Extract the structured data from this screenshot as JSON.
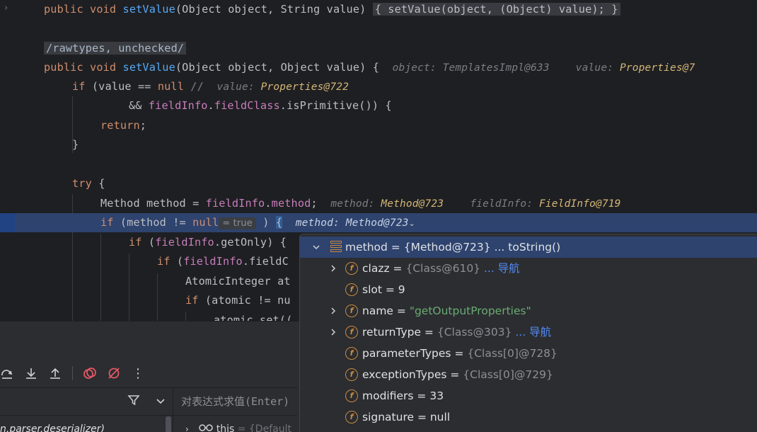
{
  "editor": {
    "lines": {
      "l1": {
        "kw": "public void ",
        "fn": "setValue",
        "args": "(Object object, String value) ",
        "fold": "{ setValue(object, (Object) value); }"
      },
      "l2": {
        "annotation": "/rawtypes, unchecked/"
      },
      "l3": {
        "kw": "public void ",
        "fn": "setValue",
        "args": "(Object object, Object value) {",
        "hint1_label": "object: ",
        "hint1_value": "TemplatesImpl@633",
        "hint2_label": "value: ",
        "hint2_value": "Properties@7"
      },
      "l4": {
        "kw": "if ",
        "code": "(value == ",
        "kw2": "null",
        "comment": " //",
        "hint_label": "value: ",
        "hint_value": "Properties@722"
      },
      "l5": {
        "pre": "&& ",
        "f1": "fieldInfo",
        "dot": ".",
        "f2": "fieldClass",
        "post": ".isPrimitive()) {"
      },
      "l6": {
        "kw": "return",
        "post": ";"
      },
      "l7": {
        "text": "}"
      },
      "l8": {
        "kw": "try ",
        "post": "{"
      },
      "l9": {
        "pre": "Method method = ",
        "f1": "fieldInfo",
        "dot": ".",
        "f2": "method",
        "post": ";",
        "hint1_label": "method: ",
        "hint1_value": "Method@723",
        "hint2_label": "fieldInfo: ",
        "hint2_value": "FieldInfo@719"
      },
      "l10": {
        "kw": "if ",
        "pre": "(method != ",
        "kw2": "null",
        "inlay": "= true",
        "post": " ) ",
        "brace": "{",
        "hint": "method: Method@723",
        "chev": "⌄"
      },
      "l11": {
        "kw": "if ",
        "pre": "(",
        "f1": "fieldInfo",
        "post": ".getOnly) {"
      },
      "l12": {
        "kw": "if ",
        "pre": "(",
        "f1": "fieldInfo",
        "post": ".fieldC"
      },
      "l13": {
        "text": "AtomicInteger at"
      },
      "l14": {
        "kw": "if ",
        "pre": "(atomic != nu"
      },
      "l15": {
        "text": "atomic.set(("
      }
    }
  },
  "popup": {
    "rows": [
      {
        "name": "method",
        "eq": " = ",
        "value": "{Method@723}",
        "extra": " ... toString()",
        "icon": "stack-icon",
        "expanded": true
      },
      {
        "name": "clazz",
        "eq": " = ",
        "value": "{Class@610}",
        "link": " ... 导航",
        "icon": "field-icon"
      },
      {
        "name": "slot",
        "eq": " = ",
        "value": "9",
        "icon": "field-icon"
      },
      {
        "name": "name",
        "eq": " = ",
        "value": "\"getOutputProperties\"",
        "icon": "field-icon"
      },
      {
        "name": "returnType",
        "eq": " = ",
        "value": "{Class@303}",
        "link": " ... 导航",
        "icon": "field-icon"
      },
      {
        "name": "parameterTypes",
        "eq": " = ",
        "value": "{Class[0]@728}",
        "icon": "field-icon"
      },
      {
        "name": "exceptionTypes",
        "eq": " = ",
        "value": "{Class[0]@729}",
        "icon": "field-icon"
      },
      {
        "name": "modifiers",
        "eq": " = ",
        "value": "33",
        "icon": "field-icon"
      },
      {
        "name": "signature",
        "eq": " = ",
        "value": "null",
        "icon": "field-icon"
      }
    ]
  },
  "debugger": {
    "eval_placeholder": "对表达式求值(Enter)",
    "frame_text": "n.parser.deserializer)",
    "this_label": "this",
    "this_value": " = {Default"
  },
  "colors": {
    "accent": "#2e436e",
    "keyword": "#cf8e6d",
    "method": "#56a8f5",
    "field": "#c77dbb",
    "hint_value": "#d5b778",
    "string": "#6aab73",
    "link": "#548af7"
  }
}
